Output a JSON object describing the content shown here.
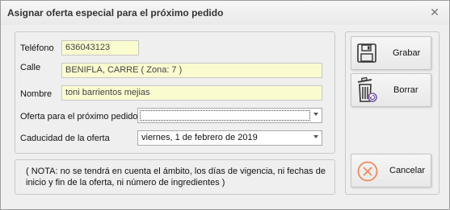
{
  "window": {
    "title": "Asignar oferta especial para el próximo pedido",
    "close_icon": "close-icon"
  },
  "form": {
    "telefono_label": "Teléfono",
    "telefono_value": "636043123",
    "calle_label": "Calle",
    "calle_value": "BENIFLA, CARRE ( Zona: 7 )",
    "nombre_label": "Nombre",
    "nombre_value": "toni barrientos mejias",
    "oferta_label": "Oferta para el próximo pedido",
    "oferta_value": "",
    "caducidad_label": "Caducidad de la oferta",
    "caducidad_value": "viernes, 1 de febrero de 2019"
  },
  "note": "( NOTA: no se tendrá en cuenta el ámbito, los días de vigencia, ni fechas de inicio y fin de la oferta, ni número de ingredientes )",
  "buttons": {
    "grabar": "Grabar",
    "borrar": "Borrar",
    "cancelar": "Cancelar"
  },
  "colors": {
    "field_background": "#fbfbd0",
    "cancel_icon": "#f08a5d"
  }
}
